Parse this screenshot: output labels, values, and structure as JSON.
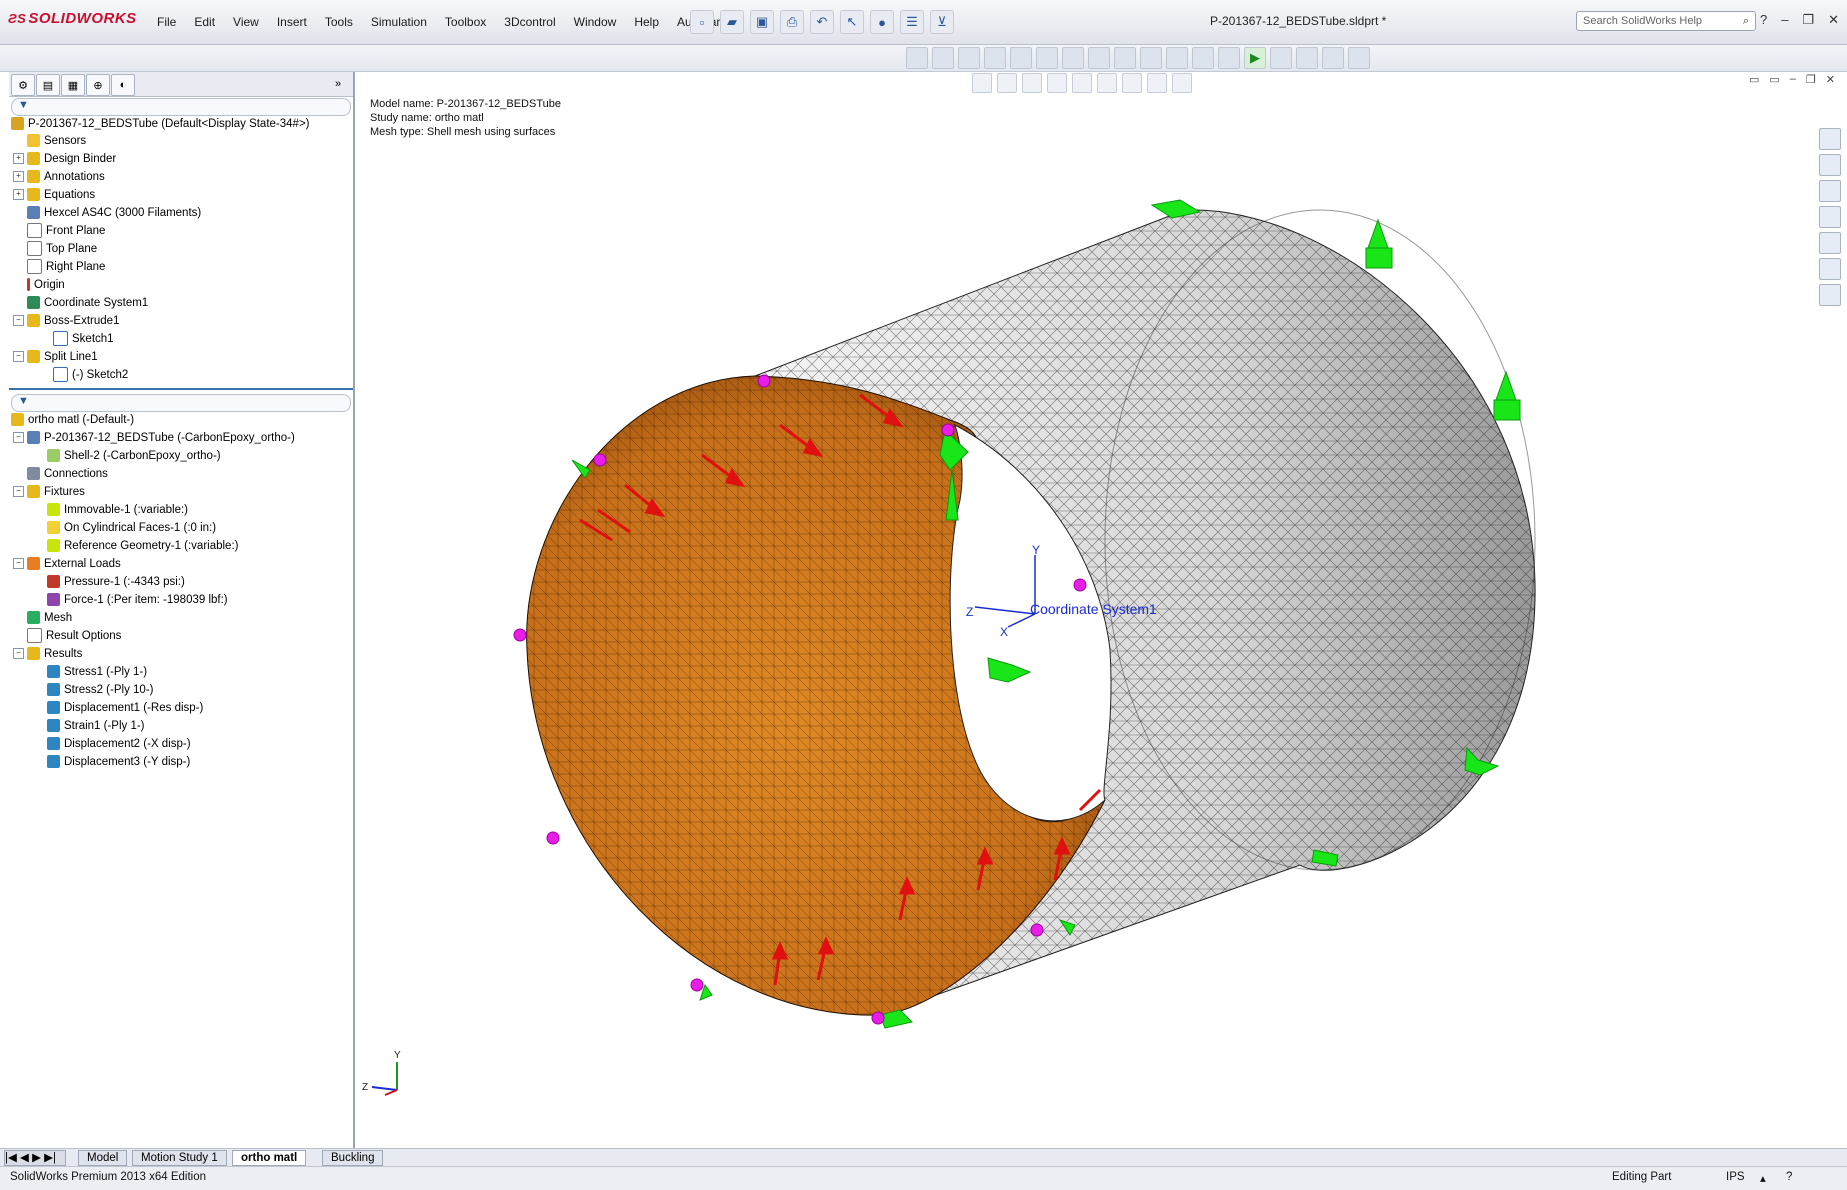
{
  "app": {
    "logo": "SOLIDWORKS",
    "doc_title": "P-201367-12_BEDSTube.sldprt *",
    "search_placeholder": "Search SolidWorks Help"
  },
  "menu": [
    "File",
    "Edit",
    "View",
    "Insert",
    "Tools",
    "Simulation",
    "Toolbox",
    "3Dcontrol",
    "Window",
    "Help",
    "AutoPart"
  ],
  "feature_tree": {
    "root": "P-201367-12_BEDSTube  (Default<Display State-34#>)",
    "items": [
      "Sensors",
      "Design Binder",
      "Annotations",
      "Equations",
      "Hexcel AS4C (3000 Filaments)",
      "Front Plane",
      "Top Plane",
      "Right Plane",
      "Origin",
      "Coordinate System1",
      "Boss-Extrude1",
      "Sketch1",
      "Split Line1",
      "(-) Sketch2"
    ]
  },
  "study_tree": {
    "root": "ortho matl (-Default-)",
    "items": [
      "P-201367-12_BEDSTube (-CarbonEpoxy_ortho-)",
      "Shell-2 (-CarbonEpoxy_ortho-)",
      "Connections",
      "Fixtures",
      "Immovable-1 (:variable:)",
      "On Cylindrical Faces-1 (:0 in:)",
      "Reference Geometry-1 (:variable:)",
      "External Loads",
      "Pressure-1 (:-4343 psi:)",
      "Force-1 (:Per item: -198039 lbf:)",
      "Mesh",
      "Result Options",
      "Results",
      "Stress1 (-Ply 1-)",
      "Stress2 (-Ply 10-)",
      "Displacement1 (-Res disp-)",
      "Strain1 (-Ply 1-)",
      "Displacement2 (-X disp-)",
      "Displacement3 (-Y disp-)"
    ]
  },
  "viewport": {
    "model_name": "Model name: P-201367-12_BEDSTube",
    "study_name": "Study name: ortho matl",
    "mesh_type": "Mesh type: Shell mesh using surfaces",
    "coord_label": "Coordinate System1",
    "axis_x": "X",
    "axis_y": "Y",
    "axis_z": "Z"
  },
  "bottom_tabs": [
    "Model",
    "Motion Study 1",
    "ortho matl",
    "Buckling"
  ],
  "status": {
    "edition": "SolidWorks Premium 2013 x64 Edition",
    "mode": "Editing Part",
    "units": "IPS"
  },
  "colors": {
    "inner": "#d27a1a",
    "outer": "#dcdcdc",
    "fixture": "#19e619",
    "load": "#e01010",
    "ref": "#e81ee8"
  }
}
